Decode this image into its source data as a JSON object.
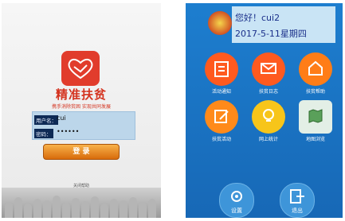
{
  "login": {
    "title": "精准扶贫",
    "slogan": "携手消除贫困  实现共同发展",
    "username_label": "用户名：",
    "username_value": "cui",
    "password_label": "密码：",
    "password_value": "••••••",
    "login_button": "登 录",
    "footer": "关闭帮助"
  },
  "home": {
    "greeting": "您好！cui2",
    "date": "2017-5-11星期四",
    "tiles": [
      {
        "label": "活动通知",
        "color": "#ff5a1f",
        "icon": "notice-icon"
      },
      {
        "label": "扶贫日志",
        "color": "#ff5a1f",
        "icon": "mail-icon"
      },
      {
        "label": "扶贫帮助",
        "color": "#ff7d17",
        "icon": "home-icon"
      },
      {
        "label": "扶贫活动",
        "color": "#ff8a1a",
        "icon": "edit-icon"
      },
      {
        "label": "网上统计",
        "color": "#f7c51a",
        "icon": "bulb-icon"
      },
      {
        "label": "地图浏览",
        "color": "#e3efe6",
        "icon": "map-icon"
      }
    ],
    "settings_label": "设置",
    "exit_label": "退出"
  }
}
